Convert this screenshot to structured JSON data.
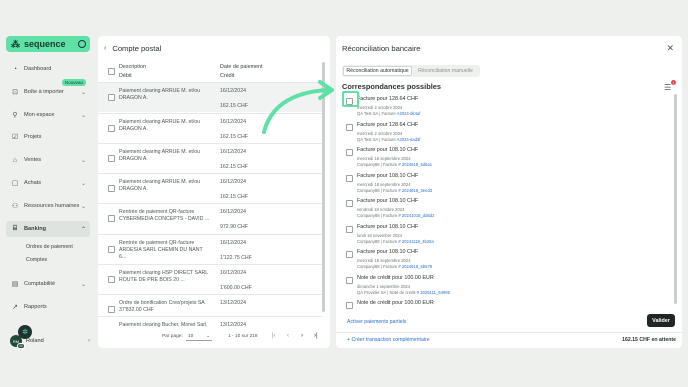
{
  "sidebar": {
    "logo": "sequence",
    "badge_new": "Nouveau",
    "items": [
      {
        "label": "Dashboard",
        "icon": "dashboard-icon"
      },
      {
        "label": "Boîte à importer",
        "icon": "inbox-icon"
      },
      {
        "label": "Mon espace",
        "icon": "person-icon"
      },
      {
        "label": "Projets",
        "icon": "check-square-icon"
      },
      {
        "label": "Ventes",
        "icon": "tag-icon"
      },
      {
        "label": "Achats",
        "icon": "bag-icon"
      },
      {
        "label": "Ressources humaines",
        "icon": "users-icon"
      },
      {
        "label": "Banking",
        "icon": "bank-icon"
      },
      {
        "label": "Comptabilité",
        "icon": "ledger-icon"
      },
      {
        "label": "Rapports",
        "icon": "chart-icon"
      }
    ],
    "sub_items": [
      "Ordres de paiement",
      "Comptes"
    ],
    "user_name": "Roland",
    "user_initials": "RM",
    "user_count": "30"
  },
  "left_panel": {
    "title": "Compte postal",
    "col1": "Description",
    "col1b": "Débit",
    "col2": "Date de paiement",
    "col2b": "Crédit",
    "rows": [
      {
        "desc": "Paiement clearing ARRUE M. et/ou DRAGON A.",
        "date": "16/12/2024",
        "amount": "162.15 CHF"
      },
      {
        "desc": "Paiement clearing ARRUE M. et/ou DRAGON A.",
        "date": "16/12/2024",
        "amount": "162.15 CHF"
      },
      {
        "desc": "Paiement clearing ARRUE M. et/ou DRAGON A.",
        "date": "16/12/2024",
        "amount": "162.15 CHF"
      },
      {
        "desc": "Paiement clearing ARRUE M. et/ou DRAGON A.",
        "date": "16/12/2024",
        "amount": "162.15 CHF"
      },
      {
        "desc": "Rentrée de paiement QR-facture CYBERMEDIA CONCEPTS - DAVID ...",
        "date": "16/12/2024",
        "amount": "972.90 CHF"
      },
      {
        "desc": "Rentrée de paiement QR-facture ARDESIA SARL CHEMIN DU NANT 6...",
        "date": "16/12/2024",
        "amount": "1'122.75 CHF"
      },
      {
        "desc": "Paiement clearing HSP DIRECT SARL ROUTE DE PRE BOIS 20 ...",
        "date": "16/12/2024",
        "amount": "1'600.00 CHF"
      },
      {
        "desc": "Ordre de bonification Crea'projets SA 37'832.00 CHF",
        "date": "13/12/2024",
        "amount": ""
      },
      {
        "desc": "Paiement clearing Bucher, Monet Sarl, ...",
        "date": "13/12/2024",
        "amount": ""
      }
    ],
    "per_page_label": "Par page:",
    "per_page_value": "10",
    "range": "1 - 10 sur 218"
  },
  "right_panel": {
    "title": "Réconciliation bancaire",
    "tab_auto": "Réconciliation automatique",
    "tab_manual": "Réconciliation manuelle",
    "section_title": "Correspondances possibles",
    "notif_count": "1",
    "matches": [
      {
        "title": "Facture pour 128.64 CHF",
        "date": "mercredi 2 octobre 2024",
        "who": "QA Test SA | Facture ",
        "ref": "A2024-dk4af"
      },
      {
        "title": "Facture pour 128.64 CHF",
        "date": "mercredi 2 octobre 2024",
        "who": "QA Test SA | Facture ",
        "ref": "A2024-sad3f"
      },
      {
        "title": "Facture pour 108.10 CHF",
        "date": "mercredi 18 septembre 2024",
        "who": "Company88 | Facture ",
        "ref": "# 2024918_5d6a1"
      },
      {
        "title": "Facture pour 108.10 CHF",
        "date": "mercredi 18 septembre 2024",
        "who": "Company88 | Facture ",
        "ref": "# 2024918_3eed3"
      },
      {
        "title": "Facture pour 108.10 CHF",
        "date": "vendredi 18 octobre 2024",
        "who": "Company88 | Facture ",
        "ref": "# 20241018_dd6d2"
      },
      {
        "title": "Facture pour 108.10 CHF",
        "date": "lundi 18 novembre 2024",
        "who": "Company88 | Facture ",
        "ref": "# 20241118_4b28a"
      },
      {
        "title": "Facture pour 108.10 CHF",
        "date": "mercredi 18 septembre 2024",
        "who": "Company88 | Facture ",
        "ref": "# 2024918_5b579"
      },
      {
        "title": "Note de crédit pour 100.00 EUR",
        "date": "dimanche 1 septembre 2024",
        "who": "QA Provider SA | Note de crédit ",
        "ref": "# 2025111_64995"
      },
      {
        "title": "Note de crédit pour 100.00 EUR",
        "date": "",
        "who": "",
        "ref": ""
      }
    ],
    "partial_link": "Activer paiements partiels",
    "validate": "Valider",
    "create_link": "Créer transaction complémentaire",
    "pending": "162.15 CHF en attente"
  },
  "colors": {
    "accent": "#5fe0a6",
    "link": "#2d6fd0",
    "dark": "#1f2624"
  }
}
